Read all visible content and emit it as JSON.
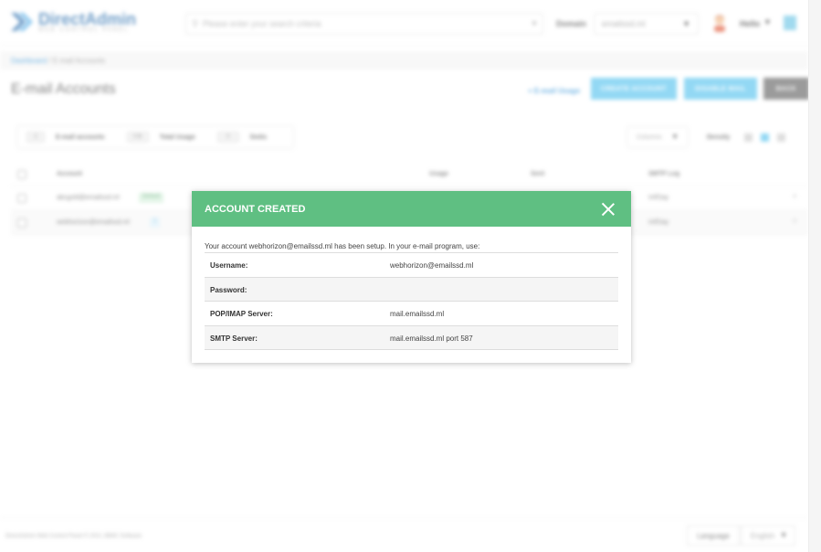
{
  "header": {
    "logo_title": "DirectAdmin",
    "logo_sub": "WEB CONTROL PANEL",
    "search_placeholder": "Please enter your search criteria",
    "domain_label": "Domain",
    "domain_value": "emailssd.ml",
    "user_name": "Hello"
  },
  "breadcrumb": {
    "home": "Dashboard",
    "separator": " / ",
    "current": "E-mail Accounts"
  },
  "page": {
    "title": "E-mail Accounts",
    "usage_link": "+ E-mail Usage",
    "create_button": "CREATE ACCOUNT",
    "disable_button": "DISABLE MAIL",
    "back_button": "BACK"
  },
  "stats": {
    "accounts_count": "2",
    "accounts_label": "E-mail accounts",
    "usage_value": "0 B",
    "usage_label": "Total Usage",
    "limit_value": "0",
    "limit_label": "limits"
  },
  "controls": {
    "columns_label": "Columns",
    "density_label": "Density"
  },
  "table": {
    "columns": [
      "Account",
      "Usage",
      "Sent",
      "SMTP Log"
    ],
    "rows": [
      {
        "account": "abcgold@emailssd.ml",
        "tag": "Default",
        "smtp": "Inf/Day"
      },
      {
        "account": "webhorizon@emailssd.ml",
        "tag": "1",
        "smtp": "Inf/Day"
      }
    ]
  },
  "footer": {
    "copyright": "DirectAdmin Web Control Panel © 2021 JBMC Software",
    "language_label": "Language",
    "language_value": "English"
  },
  "modal": {
    "title": "ACCOUNT CREATED",
    "intro": "Your account webhorizon@emailssd.ml has been setup. In your e-mail program, use:",
    "rows": [
      {
        "key": "Username:",
        "value": "webhorizon@emailssd.ml"
      },
      {
        "key": "Password:",
        "value": ""
      },
      {
        "key": "POP/IMAP Server:",
        "value": "mail.emailssd.ml"
      },
      {
        "key": "SMTP Server:",
        "value": "mail.emailssd.ml port 587"
      }
    ]
  },
  "colors": {
    "modal_header": "#5fbf82",
    "accent_blue": "#59c4ef",
    "link_blue": "#2b8fd6",
    "back_button": "#666666"
  }
}
